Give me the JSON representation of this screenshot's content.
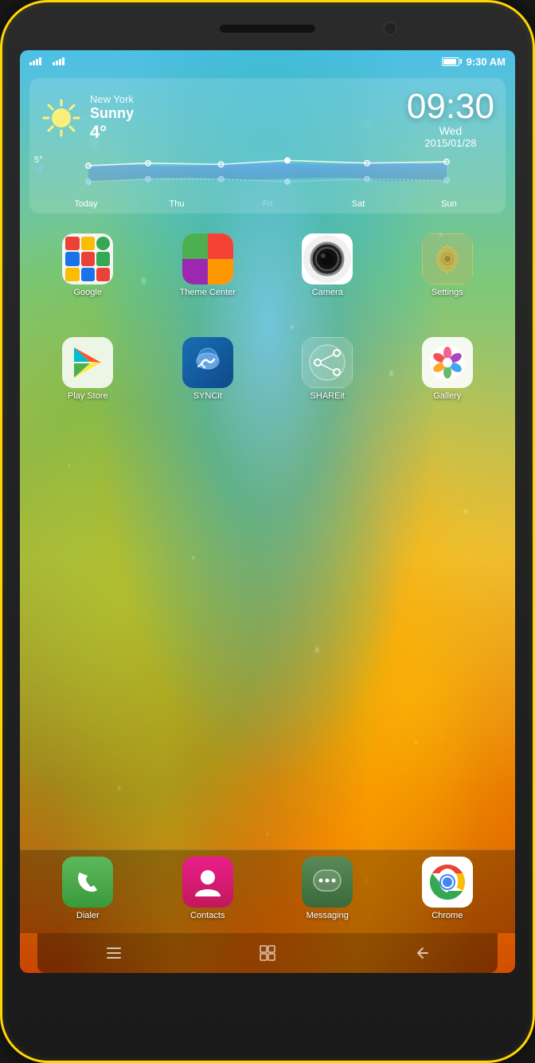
{
  "phone": {
    "border_color": "#ffd700"
  },
  "status_bar": {
    "time": "9:30 AM"
  },
  "weather": {
    "city": "New York",
    "condition": "Sunny",
    "temp": "4°",
    "temp_high": "5°",
    "temp_low": "-3°",
    "days": [
      "Today",
      "Thu",
      "Fri",
      "Sat",
      "Sun"
    ]
  },
  "clock": {
    "time": "09:30",
    "day": "Wed",
    "date": "2015/01/28"
  },
  "apps": {
    "row1": [
      {
        "name": "Google",
        "id": "google"
      },
      {
        "name": "Theme Center",
        "id": "theme"
      },
      {
        "name": "Camera",
        "id": "camera"
      },
      {
        "name": "Settings",
        "id": "settings"
      }
    ],
    "row2": [
      {
        "name": "Play Store",
        "id": "playstore"
      },
      {
        "name": "SYNCit",
        "id": "syncit"
      },
      {
        "name": "SHAREit",
        "id": "shareit"
      },
      {
        "name": "Gallery",
        "id": "gallery"
      }
    ]
  },
  "dock": [
    {
      "name": "Dialer",
      "id": "dialer"
    },
    {
      "name": "Contacts",
      "id": "contacts"
    },
    {
      "name": "Messaging",
      "id": "messaging"
    },
    {
      "name": "Chrome",
      "id": "chrome"
    }
  ],
  "nav": {
    "menu_label": "☰",
    "home_label": "⊞",
    "back_label": "↩"
  }
}
